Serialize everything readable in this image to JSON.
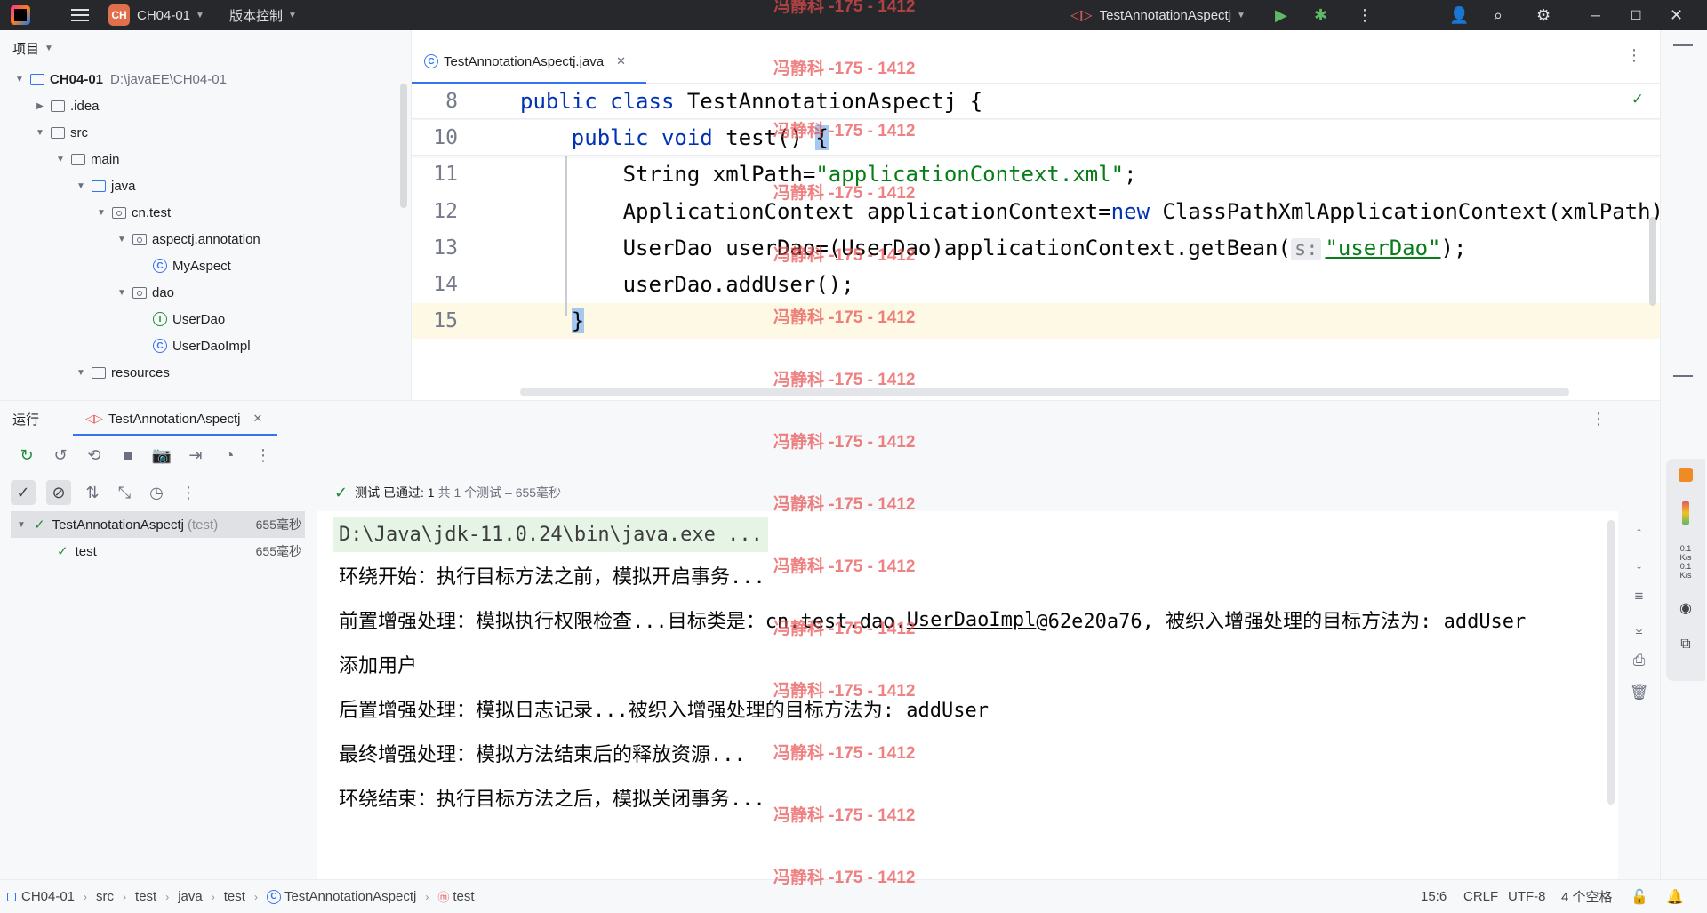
{
  "titlebar": {
    "project_badge": "CH",
    "project_name": "CH04-01",
    "vcs_label": "版本控制",
    "run_config": "TestAnnotationAspectj"
  },
  "project": {
    "header": "项目",
    "tree": [
      {
        "label": "CH04-01",
        "path": "D:\\javaEE\\CH04-01",
        "depth": 0,
        "icon": "module-icon",
        "expanded": true
      },
      {
        "label": ".idea",
        "depth": 1,
        "icon": "folder-icon",
        "expanded": false
      },
      {
        "label": "src",
        "depth": 1,
        "icon": "folder-icon",
        "expanded": true
      },
      {
        "label": "main",
        "depth": 2,
        "icon": "folder-icon",
        "expanded": true
      },
      {
        "label": "java",
        "depth": 3,
        "icon": "source-folder-icon",
        "expanded": true
      },
      {
        "label": "cn.test",
        "depth": 4,
        "icon": "package-icon",
        "expanded": true
      },
      {
        "label": "aspectj.annotation",
        "depth": 5,
        "icon": "package-icon",
        "expanded": true
      },
      {
        "label": "MyAspect",
        "depth": 6,
        "icon": "class-icon"
      },
      {
        "label": "dao",
        "depth": 5,
        "icon": "package-icon",
        "expanded": true
      },
      {
        "label": "UserDao",
        "depth": 6,
        "icon": "interface-icon"
      },
      {
        "label": "UserDaoImpl",
        "depth": 6,
        "icon": "class-icon"
      },
      {
        "label": "resources",
        "depth": 3,
        "icon": "folder-icon",
        "expanded": true
      }
    ]
  },
  "editor": {
    "tab_label": "TestAnnotationAspectj.java",
    "lines": [
      {
        "num": "8",
        "parts": [
          [
            "kw",
            "public class "
          ],
          [
            "plain",
            "TestAnnotationAspectj {"
          ]
        ]
      },
      {
        "num": "10",
        "parts": [
          [
            "plain",
            "    "
          ],
          [
            "kw",
            "public void "
          ],
          [
            "plain",
            "test() "
          ],
          [
            "brace",
            "{"
          ]
        ]
      },
      {
        "num": "11",
        "parts": [
          [
            "plain",
            "        String xmlPath="
          ],
          [
            "str",
            "\"applicationContext.xml\""
          ],
          [
            "plain",
            ";"
          ]
        ]
      },
      {
        "num": "12",
        "parts": [
          [
            "plain",
            "        ApplicationContext applicationContext="
          ],
          [
            "kw",
            "new "
          ],
          [
            "plain",
            "ClassPathXmlApplicationContext(xmlPath);"
          ]
        ]
      },
      {
        "num": "13",
        "parts": [
          [
            "plain",
            "        UserDao userDao=(UserDao)applicationContext.getBean("
          ],
          [
            "hint",
            "s:"
          ],
          [
            "str",
            "\"userDao\""
          ],
          [
            "plain",
            ");"
          ]
        ]
      },
      {
        "num": "14",
        "parts": [
          [
            "plain",
            "        userDao.addUser();"
          ]
        ]
      },
      {
        "num": "15",
        "parts": [
          [
            "plain",
            "    "
          ],
          [
            "brace",
            "}"
          ]
        ]
      }
    ]
  },
  "run": {
    "header": "运行",
    "tab_label": "TestAnnotationAspectj",
    "status_pass": "测试 已通过: 1",
    "status_detail": "共 1 个测试 – 655毫秒",
    "tests": [
      {
        "name": "TestAnnotationAspectj",
        "suffix": "(test)",
        "time": "655毫秒"
      },
      {
        "name": "test",
        "suffix": "",
        "time": "655毫秒"
      }
    ],
    "console": {
      "cmd": "D:\\Java\\jdk-11.0.24\\bin\\java.exe ...",
      "l1": "环绕开始：执行目标方法之前，模拟开启事务...",
      "l2_a": "前置增强处理：模拟执行权限检查...目标类是：cn.test.dao.",
      "l2_b": "UserDaoImpl",
      "l2_c": "@62e20a76, 被织入增强处理的目标方法为: addUser",
      "l3": "添加用户",
      "l4": "后置增强处理：模拟日志记录...被织入增强处理的目标方法为: addUser",
      "l5": "最终增强处理：模拟方法结束后的释放资源...",
      "l6": "环绕结束：执行目标方法之后，模拟关闭事务..."
    }
  },
  "statusbar": {
    "crumbs": [
      "CH04-01",
      "src",
      "test",
      "java",
      "test",
      "TestAnnotationAspectj",
      "test"
    ],
    "position": "15:6",
    "line_sep": "CRLF",
    "encoding": "UTF-8",
    "indent": "4 个空格"
  },
  "watermark": "冯静科 -175 - 1412",
  "colors": {
    "accent": "#3574f0",
    "pass": "#208a3c",
    "keyword": "#0033b3",
    "string": "#067d17",
    "watermark": "#e74c4c"
  }
}
